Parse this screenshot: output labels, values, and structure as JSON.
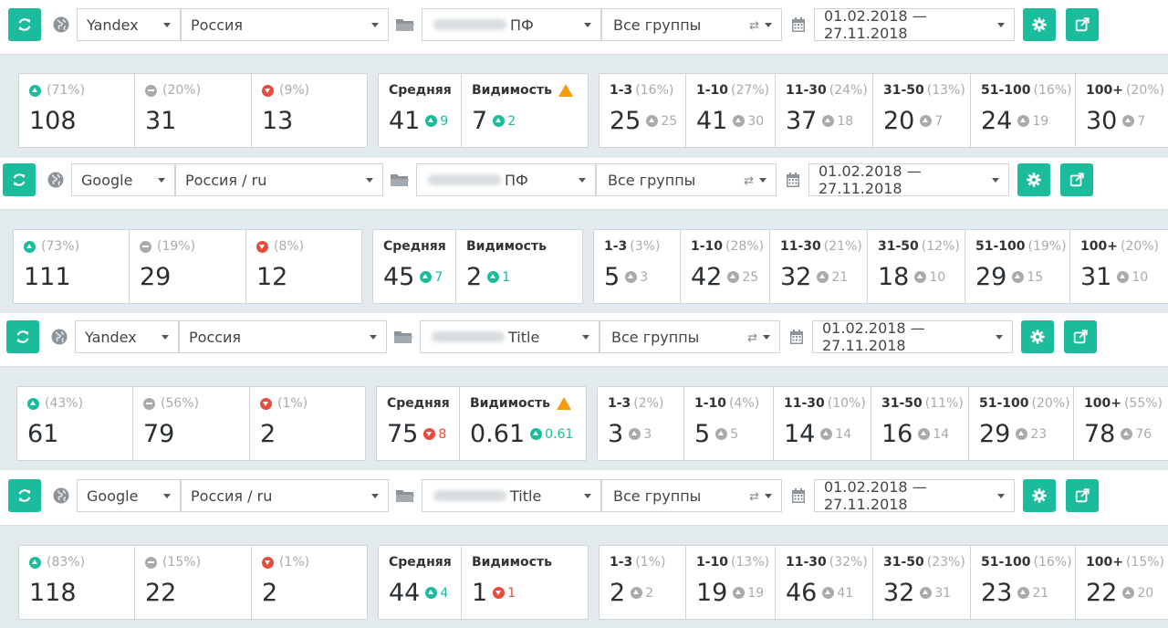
{
  "sections": [
    {
      "engine": "Yandex",
      "region": "Россия",
      "project_suffix": "ПФ",
      "groups": "Все группы",
      "date_range": "01.02.2018 — 27.11.2018",
      "summary": [
        {
          "pct": "(71%)",
          "value": "108",
          "kind": "up"
        },
        {
          "pct": "(20%)",
          "value": "31",
          "kind": "neutral"
        },
        {
          "pct": "(9%)",
          "value": "13",
          "kind": "down"
        }
      ],
      "avg": {
        "label": "Средняя",
        "value": "41",
        "delta": "9",
        "dir": "up"
      },
      "vis": {
        "label": "Видимость",
        "value": "7",
        "delta": "2",
        "dir": "up",
        "warning": true
      },
      "ranges": [
        {
          "label": "1-3",
          "pct": "(16%)",
          "value": "25",
          "delta": "25"
        },
        {
          "label": "1-10",
          "pct": "(27%)",
          "value": "41",
          "delta": "30"
        },
        {
          "label": "11-30",
          "pct": "(24%)",
          "value": "37",
          "delta": "18"
        },
        {
          "label": "31-50",
          "pct": "(13%)",
          "value": "20",
          "delta": "7"
        },
        {
          "label": "51-100",
          "pct": "(16%)",
          "value": "24",
          "delta": "19"
        },
        {
          "label": "100+",
          "pct": "(20%)",
          "value": "30",
          "delta": "7"
        }
      ]
    },
    {
      "engine": "Google",
      "region": "Россия / ru",
      "project_suffix": "ПФ",
      "groups": "Все группы",
      "date_range": "01.02.2018 — 27.11.2018",
      "summary": [
        {
          "pct": "(73%)",
          "value": "111",
          "kind": "up"
        },
        {
          "pct": "(19%)",
          "value": "29",
          "kind": "neutral"
        },
        {
          "pct": "(8%)",
          "value": "12",
          "kind": "down"
        }
      ],
      "avg": {
        "label": "Средняя",
        "value": "45",
        "delta": "7",
        "dir": "up"
      },
      "vis": {
        "label": "Видимость",
        "value": "2",
        "delta": "1",
        "dir": "up",
        "warning": false
      },
      "ranges": [
        {
          "label": "1-3",
          "pct": "(3%)",
          "value": "5",
          "delta": "3"
        },
        {
          "label": "1-10",
          "pct": "(28%)",
          "value": "42",
          "delta": "25"
        },
        {
          "label": "11-30",
          "pct": "(21%)",
          "value": "32",
          "delta": "21"
        },
        {
          "label": "31-50",
          "pct": "(12%)",
          "value": "18",
          "delta": "10"
        },
        {
          "label": "51-100",
          "pct": "(19%)",
          "value": "29",
          "delta": "15"
        },
        {
          "label": "100+",
          "pct": "(20%)",
          "value": "31",
          "delta": "10"
        }
      ]
    },
    {
      "engine": "Yandex",
      "region": "Россия",
      "project_suffix": "Title",
      "groups": "Все группы",
      "date_range": "01.02.2018 — 27.11.2018",
      "summary": [
        {
          "pct": "(43%)",
          "value": "61",
          "kind": "up"
        },
        {
          "pct": "(56%)",
          "value": "79",
          "kind": "neutral"
        },
        {
          "pct": "(1%)",
          "value": "2",
          "kind": "down"
        }
      ],
      "avg": {
        "label": "Средняя",
        "value": "75",
        "delta": "8",
        "dir": "down"
      },
      "vis": {
        "label": "Видимость",
        "value": "0.61",
        "delta": "0.61",
        "dir": "up",
        "warning": true
      },
      "ranges": [
        {
          "label": "1-3",
          "pct": "(2%)",
          "value": "3",
          "delta": "3"
        },
        {
          "label": "1-10",
          "pct": "(4%)",
          "value": "5",
          "delta": "5"
        },
        {
          "label": "11-30",
          "pct": "(10%)",
          "value": "14",
          "delta": "14"
        },
        {
          "label": "31-50",
          "pct": "(11%)",
          "value": "16",
          "delta": "14"
        },
        {
          "label": "51-100",
          "pct": "(20%)",
          "value": "29",
          "delta": "23"
        },
        {
          "label": "100+",
          "pct": "(55%)",
          "value": "78",
          "delta": "76"
        }
      ]
    },
    {
      "engine": "Google",
      "region": "Россия / ru",
      "project_suffix": "Title",
      "groups": "Все группы",
      "date_range": "01.02.2018 — 27.11.2018",
      "summary": [
        {
          "pct": "(83%)",
          "value": "118",
          "kind": "up"
        },
        {
          "pct": "(15%)",
          "value": "22",
          "kind": "neutral"
        },
        {
          "pct": "(1%)",
          "value": "2",
          "kind": "down"
        }
      ],
      "avg": {
        "label": "Средняя",
        "value": "44",
        "delta": "4",
        "dir": "up"
      },
      "vis": {
        "label": "Видимость",
        "value": "1",
        "delta": "1",
        "dir": "down",
        "warning": false
      },
      "ranges": [
        {
          "label": "1-3",
          "pct": "(1%)",
          "value": "2",
          "delta": "2"
        },
        {
          "label": "1-10",
          "pct": "(13%)",
          "value": "19",
          "delta": "19"
        },
        {
          "label": "11-30",
          "pct": "(32%)",
          "value": "46",
          "delta": "41"
        },
        {
          "label": "31-50",
          "pct": "(23%)",
          "value": "32",
          "delta": "31"
        },
        {
          "label": "51-100",
          "pct": "(16%)",
          "value": "23",
          "delta": "21"
        },
        {
          "label": "100+",
          "pct": "(15%)",
          "value": "22",
          "delta": "20"
        }
      ]
    }
  ],
  "colors": {
    "accent": "#1abc9c",
    "down": "#e74c3c",
    "warning": "#f39c12",
    "panel_bg": "#e3eaee"
  },
  "icons": [
    "refresh-icon",
    "globe-icon",
    "folder-icon",
    "sync-icon",
    "calendar-icon",
    "gear-icon",
    "export-icon"
  ]
}
